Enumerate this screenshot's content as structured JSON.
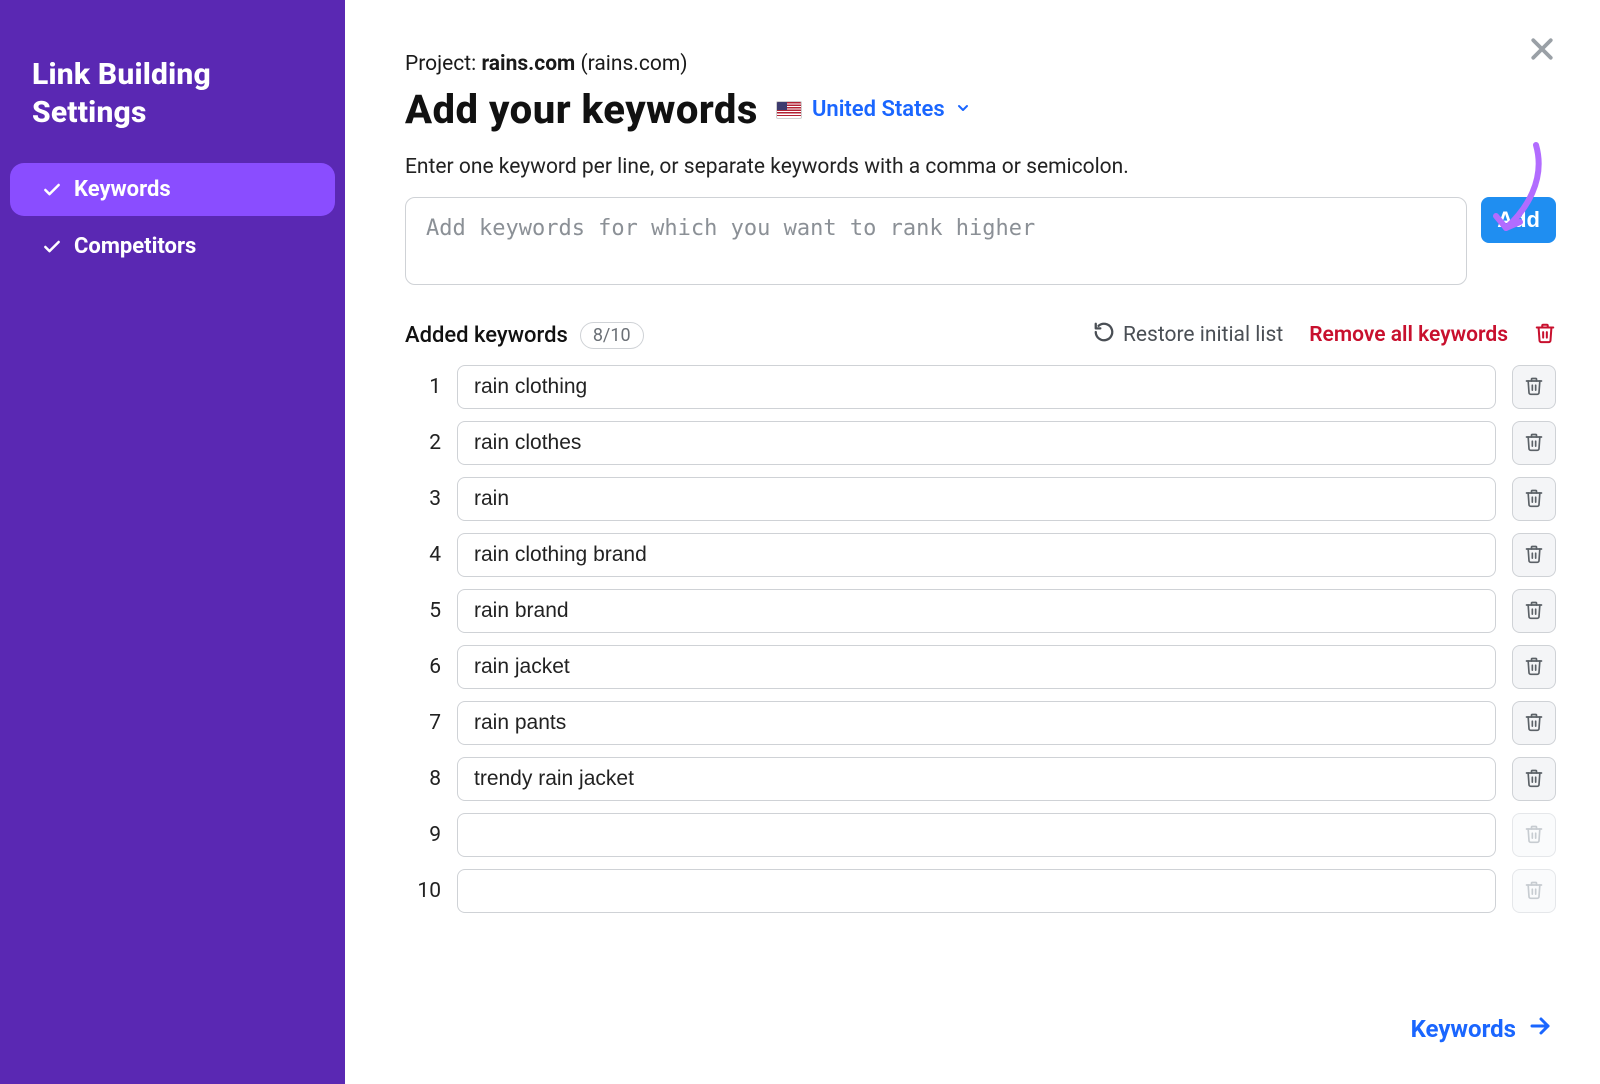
{
  "sidebar": {
    "title": "Link Building Settings",
    "items": [
      {
        "label": "Keywords",
        "active": true
      },
      {
        "label": "Competitors",
        "active": false
      }
    ]
  },
  "project": {
    "prefix": "Project: ",
    "name": "rains.com",
    "domain_label": "(rains.com)"
  },
  "heading": "Add your keywords",
  "country": {
    "label": "United States"
  },
  "instructions": "Enter one keyword per line, or separate keywords with a comma or semicolon.",
  "input": {
    "placeholder": "Add keywords for which you want to rank higher"
  },
  "add_label": "Add",
  "added": {
    "title": "Added keywords",
    "badge": "8/10",
    "restore_label": "Restore initial list",
    "remove_all_label": "Remove all keywords"
  },
  "keywords": [
    "rain clothing",
    "rain clothes",
    "rain",
    "rain clothing brand",
    "rain brand",
    "rain jacket",
    "rain pants",
    "trendy rain jacket",
    "",
    ""
  ],
  "footer": {
    "next_label": "Keywords"
  }
}
